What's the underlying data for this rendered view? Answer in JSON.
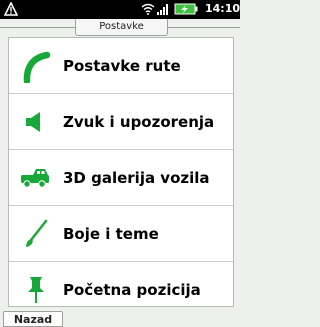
{
  "status_bar": {
    "time": "14:10"
  },
  "screen": {
    "title": "Postavke"
  },
  "menu": {
    "items": [
      {
        "label": "Postavke rute",
        "icon": "route-icon"
      },
      {
        "label": "Zvuk i upozorenja",
        "icon": "speaker-icon"
      },
      {
        "label": "3D galerija vozila",
        "icon": "vehicle-icon"
      },
      {
        "label": "Boje i teme",
        "icon": "brush-icon"
      },
      {
        "label": "Početna pozicija",
        "icon": "pin-icon"
      }
    ]
  },
  "footer": {
    "back_label": "Nazad"
  },
  "colors": {
    "accent": "#18a83a",
    "status_bar": "#000000"
  }
}
